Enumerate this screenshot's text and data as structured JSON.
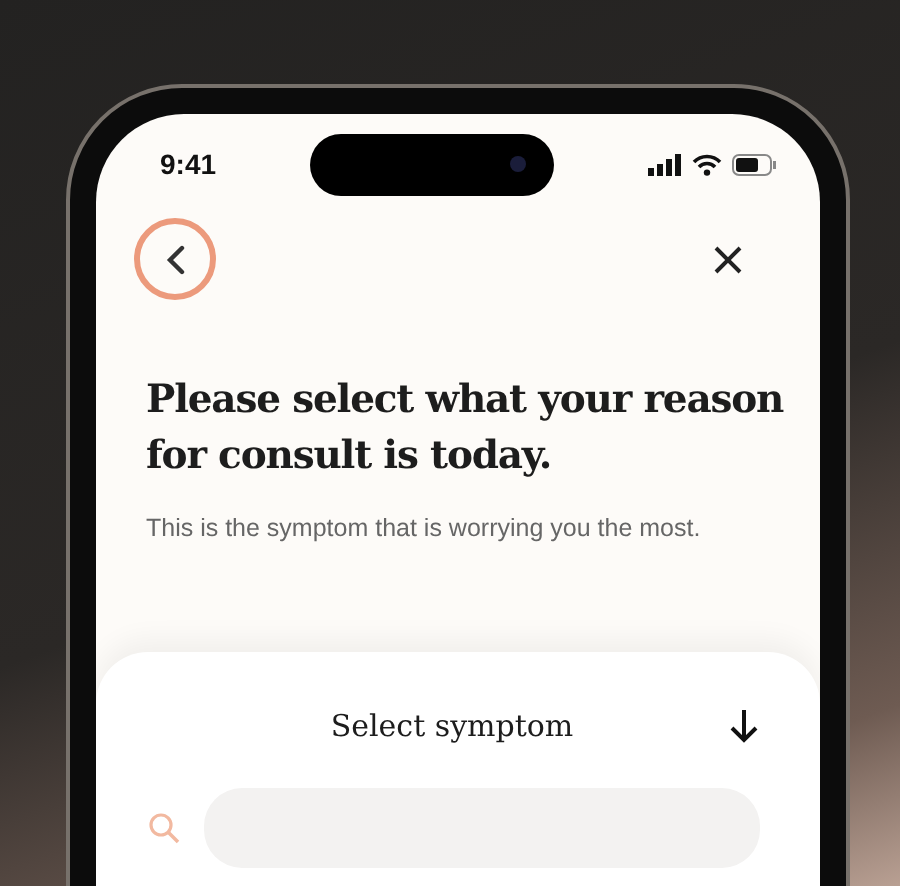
{
  "status_bar": {
    "time": "9:41"
  },
  "title": "Please select what your reason for consult is today.",
  "subtitle": "This is the symptom that is worrying you the most.",
  "sheet": {
    "title": "Select symptom"
  }
}
